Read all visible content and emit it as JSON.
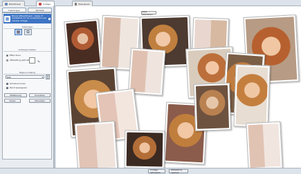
{
  "app": {
    "tabs": [
      {
        "label": "Bibliotheek",
        "color": "#6b8cb8"
      },
      {
        "label": "Collage",
        "color": "#c24b4b"
      },
      {
        "label": "Weergeven",
        "color": "#7b7b7b"
      }
    ]
  },
  "panel": {
    "tabs": [
      "Instellingen",
      "Opmaak"
    ],
    "info": {
      "icon": "layout-icon",
      "text": "Nieuw afbeeldingen - sleep of dubbelklik om te verwijderen van nieuwe collage."
    },
    "layout_section": "Indelingen",
    "background_section": "Achtergrondkleur",
    "background_options": [
      "Effen kleur",
      "Afbeelding gebruiken"
    ],
    "size_section": "Pagina-indeling",
    "size_value": "6x4",
    "checks": [
      "Schaduw tonen",
      "Rand weergeven"
    ],
    "buttons": {
      "random": "Willekeurig",
      "shuffle": "Schudden",
      "layout": "Vullen",
      "preview": "Afdrukken"
    }
  },
  "canvas": {
    "toggle_label": "Alles selecteren"
  },
  "bottombar": {
    "left_button": "Collage afdrukken",
    "right_button": "Afbeelding opslaan"
  },
  "colors": {
    "accent": "#3e74c4"
  }
}
